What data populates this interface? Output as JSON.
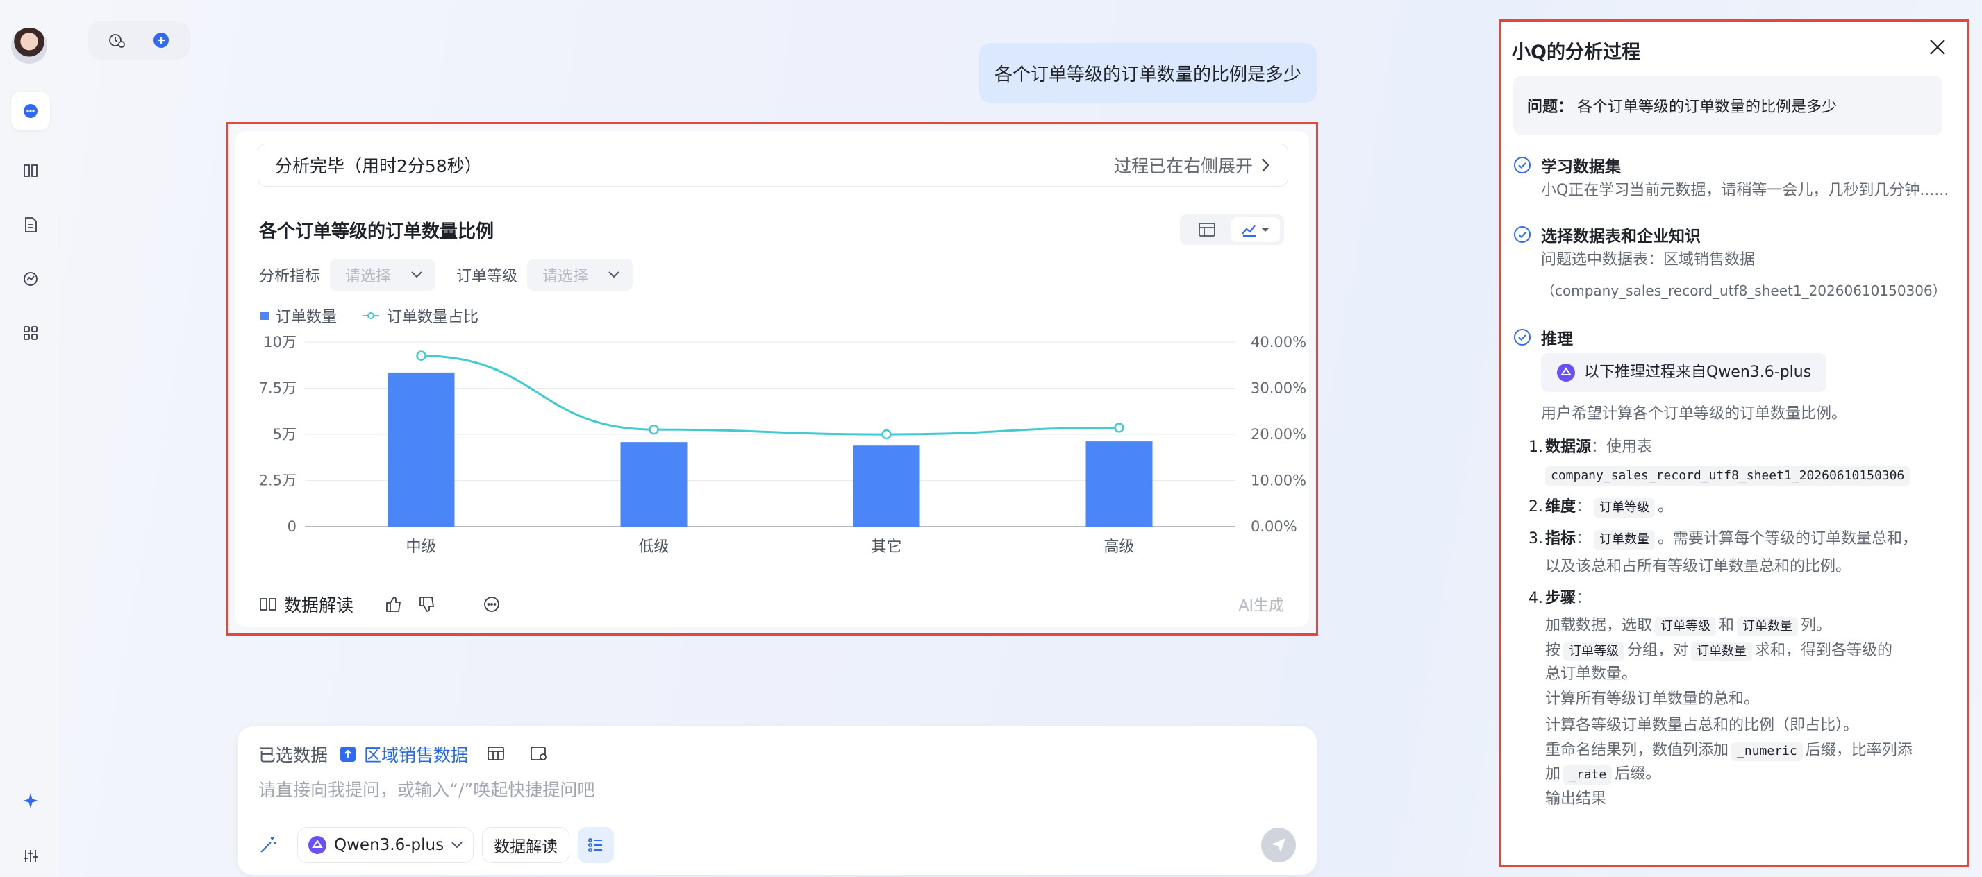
{
  "rail": {
    "items": [
      "chat",
      "knowledge",
      "report",
      "analysis",
      "apps"
    ],
    "bottom": [
      "sparkle",
      "settings"
    ]
  },
  "top_pill": {
    "icons": [
      "history-icon",
      "add-icon"
    ]
  },
  "user_message": "各个订单等级的订单数量的比例是多少",
  "answer": {
    "status": "分析完毕（用时2分58秒）",
    "status_right": "过程已在右侧展开",
    "filters": [
      {
        "label": "分析指标",
        "placeholder": "请选择"
      },
      {
        "label": "订单等级",
        "placeholder": "请选择"
      }
    ],
    "footer": {
      "interpret": "数据解读",
      "ai_tag": "AI生成"
    }
  },
  "chart_data": {
    "type": "bar",
    "title": "各个订单等级的订单数量比例",
    "categories": [
      "中级",
      "低级",
      "其它",
      "高级"
    ],
    "series": [
      {
        "name": "订单数量",
        "type": "bar",
        "axis": "left",
        "values": [
          83500,
          45800,
          43900,
          46200
        ],
        "color": "#4a86f7"
      },
      {
        "name": "订单数量占比",
        "type": "line",
        "axis": "right",
        "values": [
          0.3704,
          0.2103,
          0.1999,
          0.2145
        ],
        "color": "#3fcad4"
      }
    ],
    "y_left": {
      "ticks": [
        "0",
        "2.5万",
        "5万",
        "7.5万",
        "10万"
      ],
      "range": [
        0,
        100000
      ]
    },
    "y_right": {
      "ticks": [
        "0.00%",
        "10.00%",
        "20.00%",
        "30.00%",
        "40.00%"
      ],
      "range": [
        0,
        0.4
      ]
    },
    "legend": "top-left",
    "grid": true
  },
  "input": {
    "selected_label": "已选数据",
    "dataset": "区域销售数据",
    "placeholder": "请直接向我提问，或输入“/”唤起快捷提问吧",
    "model": "Qwen3.6-plus",
    "chip": "数据解读"
  },
  "panel": {
    "title": "小Q的分析过程",
    "question_label": "问题：",
    "question": "各个订单等级的订单数量的比例是多少",
    "steps": [
      {
        "title": "学习数据集",
        "lines": [
          "小Q正在学习当前元数据，请稍等一会儿，几秒到几分钟......"
        ]
      },
      {
        "title": "选择数据表和企业知识",
        "lines": [
          "问题选中数据表：区域销售数据",
          "（company_sales_record_utf8_sheet1_20260610150306）"
        ]
      },
      {
        "title": "推理",
        "source": "以下推理过程来自Qwen3.6-plus",
        "intro": "用户希望计算各个订单等级的订单数量比例。"
      }
    ],
    "reason": {
      "r1_num": "1.",
      "r1_title": "数据源",
      "r1_text": "：使用表",
      "r1_code": "company_sales_record_utf8_sheet1_20260610150306",
      "r2_num": "2.",
      "r2_title": "维度",
      "r2_sep": "：",
      "r2_code": "订单等级",
      "r2_end": "。",
      "r3_num": "3.",
      "r3_title": "指标",
      "r3_sep": "：",
      "r3_code": "订单数量",
      "r3_text": "。需要计算每个等级的订单数量总和，",
      "r3_text2": "以及该总和占所有等级订单数量总和的比例。",
      "r4_num": "4.",
      "r4_title": "步骤",
      "r4_sep": "：",
      "s1_a": "加载数据，选取",
      "s1_code1": "订单等级",
      "s1_b": "和",
      "s1_code2": "订单数量",
      "s1_c": "列。",
      "s2_a": "按",
      "s2_code1": "订单等级",
      "s2_b": "分组，对",
      "s2_code2": "订单数量",
      "s2_c": "求和，得到各等级的",
      "s2_d": "总订单数量。",
      "s3": "计算所有等级订单数量的总和。",
      "s4": "计算各等级订单数量占总和的比例（即占比）。",
      "s5_a": "重命名结果列，数值列添加",
      "s5_code1": "_numeric",
      "s5_b": "后缀，比率列添",
      "s5_c": "加",
      "s5_code2": "_rate",
      "s5_d": "后缀。",
      "s6": "输出结果"
    }
  }
}
